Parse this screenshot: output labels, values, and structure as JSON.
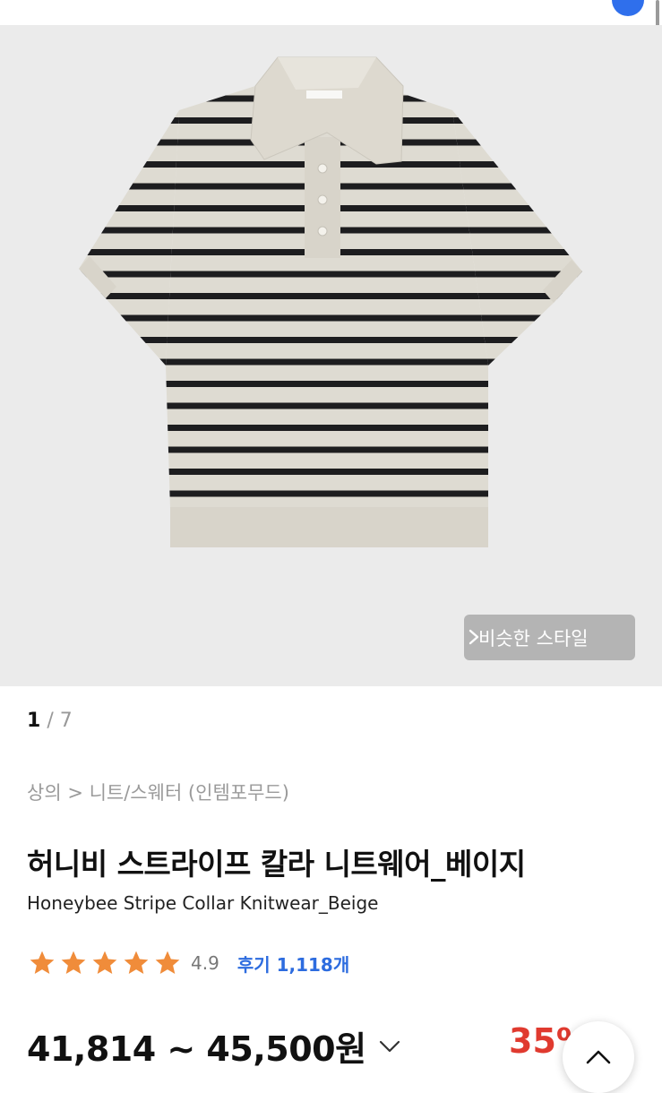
{
  "gallery": {
    "current": "1",
    "separator": "/",
    "total": "7"
  },
  "similar_style_label": "비슷한 스타일",
  "breadcrumb": "상의 > 니트/스웨터 (인템포무드)",
  "product": {
    "title_ko": "허니비 스트라이프 칼라 니트웨어_베이지",
    "title_en": "Honeybee Stripe Collar Knitwear_Beige",
    "stars": 5,
    "rating": "4.9",
    "reviews_label": "후기 1,118개",
    "price": "41,814 ~ 45,500원",
    "discount": "35%"
  },
  "colors": {
    "accent_blue": "#2d6cdf",
    "discount_red": "#e03a2f",
    "star_orange": "#f08c3a"
  },
  "icons": [
    "chevron-right-icon",
    "star-icon",
    "chevron-down-icon",
    "chevron-up-icon"
  ]
}
